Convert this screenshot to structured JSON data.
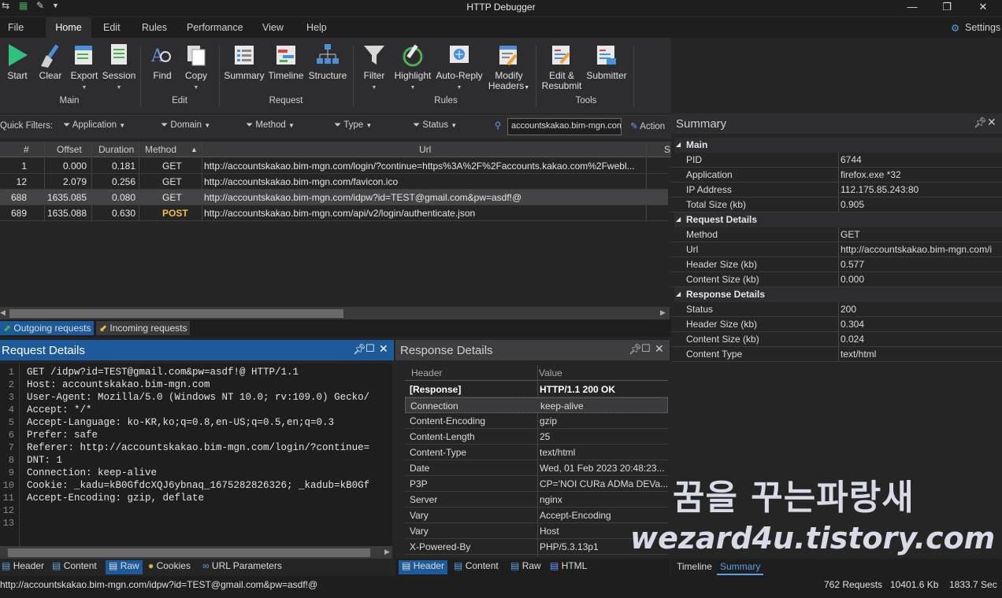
{
  "app": {
    "title": "HTTP Debugger",
    "settings_label": "Settings"
  },
  "menu": {
    "tabs": [
      "File",
      "Home",
      "Edit",
      "Rules",
      "Performance",
      "View",
      "Help"
    ]
  },
  "ribbon": {
    "buttons": {
      "start": "Start",
      "clear": "Clear",
      "export": "Export",
      "session": "Session",
      "find": "Find",
      "copy": "Copy",
      "summary": "Summary",
      "timeline": "Timeline",
      "structure": "Structure",
      "filter": "Filter",
      "highlight": "Highlight",
      "auto_reply": "Auto-Reply",
      "modify_headers_1": "Modify",
      "modify_headers_2": "Headers",
      "edit_resubmit_1": "Edit &",
      "edit_resubmit_2": "Resubmit",
      "submitter": "Submitter"
    },
    "groups": {
      "main": "Main",
      "edit": "Edit",
      "request": "Request",
      "rules": "Rules",
      "tools": "Tools"
    }
  },
  "quick_filters": {
    "label": "Quick Filters:",
    "application": "Application",
    "domain": "Domain",
    "method": "Method",
    "type": "Type",
    "status": "Status",
    "search_value": "accountskakao.bim-mgn.com",
    "actions": "Action"
  },
  "grid": {
    "columns": {
      "num": "#",
      "offset": "Offset",
      "duration": "Duration",
      "method": "Method",
      "url": "Url",
      "s": "S"
    },
    "rows": [
      {
        "num": "1",
        "offset": "0.000",
        "duration": "0.181",
        "method": "GET",
        "url": "http://accountskakao.bim-mgn.com/login/?continue=https%3A%2F%2Faccounts.kakao.com%2Fwebl..."
      },
      {
        "num": "12",
        "offset": "2.079",
        "duration": "0.256",
        "method": "GET",
        "url": "http://accountskakao.bim-mgn.com/favicon.ico"
      },
      {
        "num": "688",
        "offset": "1635.085",
        "duration": "0.080",
        "method": "GET",
        "url": "http://accountskakao.bim-mgn.com/idpw?id=TEST@gmail.com&pw=asdf!@"
      },
      {
        "num": "689",
        "offset": "1635.088",
        "duration": "0.630",
        "method": "POST",
        "url": "http://accountskakao.bim-mgn.com/api/v2/login/authenticate.json"
      }
    ],
    "selected_row": 2,
    "tabs": {
      "outgoing": "Outgoing requests",
      "incoming": "Incoming requests"
    }
  },
  "request_details": {
    "title": "Request Details",
    "lines": [
      "GET /idpw?id=TEST@gmail.com&pw=asdf!@ HTTP/1.1",
      "Host: accountskakao.bim-mgn.com",
      "User-Agent: Mozilla/5.0 (Windows NT 10.0; rv:109.0) Gecko/",
      "Accept: */*",
      "Accept-Language: ko-KR,ko;q=0.8,en-US;q=0.5,en;q=0.3",
      "Prefer: safe",
      "Referer: http://accountskakao.bim-mgn.com/login/?continue=",
      "DNT: 1",
      "Connection: keep-alive",
      "Cookie: _kadu=kB0GfdcXQJ6ybnaq_1675282826326; _kadub=kB0Gf",
      "Accept-Encoding: gzip, deflate",
      "",
      ""
    ],
    "line_numbers": [
      "1",
      "2",
      "3",
      "4",
      "5",
      "6",
      "7",
      "8",
      "9",
      "10",
      "11",
      "12",
      "13"
    ],
    "tabs": {
      "header": "Header",
      "content": "Content",
      "raw": "Raw",
      "cookies": "Cookies",
      "url_params": "URL Parameters"
    }
  },
  "response_details": {
    "title": "Response Details",
    "col_header": "Header",
    "col_value": "Value",
    "rows": [
      {
        "h": "[Response]",
        "v": "HTTP/1.1 200 OK"
      },
      {
        "h": "Connection",
        "v": "keep-alive"
      },
      {
        "h": "Content-Encoding",
        "v": "gzip"
      },
      {
        "h": "Content-Length",
        "v": "25"
      },
      {
        "h": "Content-Type",
        "v": "text/html"
      },
      {
        "h": "Date",
        "v": "Wed, 01 Feb 2023 20:48:23..."
      },
      {
        "h": "P3P",
        "v": "CP='NOI CURa ADMa DEVa..."
      },
      {
        "h": "Server",
        "v": "nginx"
      },
      {
        "h": "Vary",
        "v": "Accept-Encoding"
      },
      {
        "h": "Vary",
        "v": "Host"
      },
      {
        "h": "X-Powered-By",
        "v": "PHP/5.3.13p1"
      }
    ],
    "tabs": {
      "header": "Header",
      "content": "Content",
      "raw": "Raw",
      "html": "HTML"
    }
  },
  "summary": {
    "title": "Summary",
    "main": "Main",
    "pid_k": "PID",
    "pid_v": "6744",
    "app_k": "Application",
    "app_v": "firefox.exe *32",
    "ip_k": "IP Address",
    "ip_v": "112.175.85.243:80",
    "total_k": "Total Size (kb)",
    "total_v": "0.905",
    "req": "Request Details",
    "method_k": "Method",
    "method_v": "GET",
    "url_k": "Url",
    "url_v": "http://accountskakao.bim-mgn.com/i",
    "rq_hs_k": "Header Size (kb)",
    "rq_hs_v": "0.577",
    "rq_cs_k": "Content Size (kb)",
    "rq_cs_v": "0.000",
    "resp": "Response Details",
    "status_k": "Status",
    "status_v": "200",
    "rs_hs_k": "Header Size (kb)",
    "rs_hs_v": "0.304",
    "rs_cs_k": "Content Size (kb)",
    "rs_cs_v": "0.024",
    "ct_k": "Content Type",
    "ct_v": "text/html",
    "tabs": {
      "timeline": "Timeline",
      "summary": "Summary"
    }
  },
  "status": {
    "url": "http://accountskakao.bim-mgn.com/idpw?id=TEST@gmail.com&pw=asdf!@",
    "requests": "762 Requests",
    "kb": "10401.6 Kb",
    "sec": "1833.7 Sec"
  },
  "watermark": {
    "line1": "꿈을 꾸는파랑새",
    "line2": "wezard4u.tistory.com"
  }
}
